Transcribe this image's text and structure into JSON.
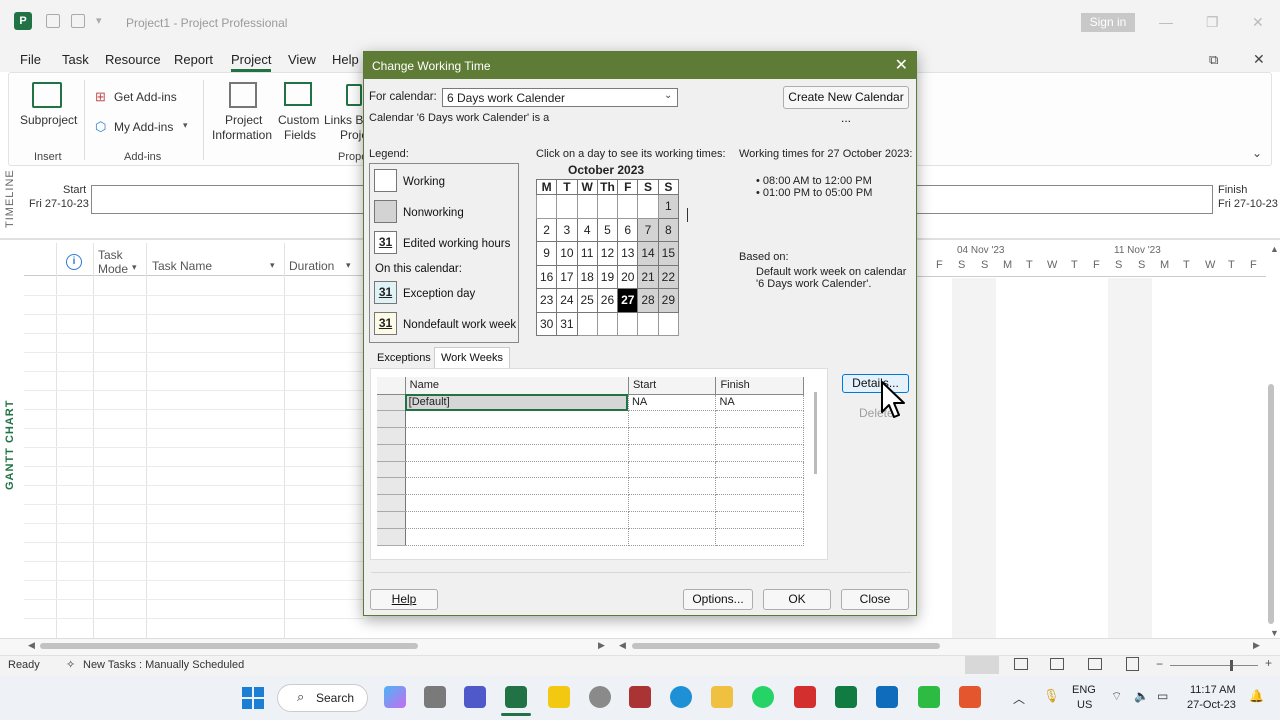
{
  "app": {
    "title": "Project1  -  Project Professional",
    "sign_in": "Sign in",
    "icon_letter": "P"
  },
  "menu": [
    "File",
    "Task",
    "Resource",
    "Report",
    "Project",
    "View",
    "Help"
  ],
  "ribbon": {
    "subproject": "Subproject",
    "insert_group": "Insert",
    "get_addins": "Get Add-ins",
    "my_addins": "My Add-ins",
    "addins_group": "Add-ins",
    "project_information_1": "Project",
    "project_information_2": "Information",
    "custom_fields_1": "Custom",
    "custom_fields_2": "Fields",
    "links_between_1": "Links Be",
    "links_between_2": "Proje",
    "properties_group": "Prope"
  },
  "timeline": {
    "side_label": "TIMELINE",
    "start_label": "Start",
    "start_date": "Fri 27-10-23",
    "finish_label": "Finish",
    "finish_date": "Fri 27-10-23"
  },
  "gantt": {
    "side_label": "GANTT CHART",
    "col_task_mode_1": "Task",
    "col_task_mode_2": "Mode",
    "col_task_name": "Task Name",
    "col_duration": "Duration",
    "week1": "04 Nov '23",
    "week2": "11 Nov '23",
    "day_letters": [
      "F",
      "S",
      "S",
      "M",
      "T",
      "W",
      "T",
      "F",
      "S",
      "S",
      "M",
      "T",
      "W",
      "T",
      "F"
    ]
  },
  "status": {
    "ready": "Ready",
    "new_tasks": "New Tasks : Manually Scheduled"
  },
  "taskbar": {
    "search": "Search",
    "lang1": "ENG",
    "lang2": "US",
    "time": "11:17 AM",
    "date": "27-Oct-23"
  },
  "dialog": {
    "title": "Change Working Time",
    "for_calendar_label": "For calendar:",
    "calendar_value": "6 Days work Calender",
    "create_new_calendar": "Create New Calendar ...",
    "calendar_note": "Calendar '6 Days work Calender' is a",
    "legend_label": "Legend:",
    "legend": {
      "working": "Working",
      "nonworking": "Nonworking",
      "edited": "Edited working hours",
      "on_this_calendar": "On this calendar:",
      "exception_day": "Exception day",
      "nondefault": "Nondefault work week",
      "day_number": "31"
    },
    "click_hint": "Click on a day to see its working times:",
    "month_title": "October 2023",
    "weekdays": [
      "M",
      "T",
      "W",
      "Th",
      "F",
      "S",
      "S"
    ],
    "calendar_rows": [
      [
        "",
        "",
        "",
        "",
        "",
        "",
        "1"
      ],
      [
        "2",
        "3",
        "4",
        "5",
        "6",
        "7",
        "8"
      ],
      [
        "9",
        "10",
        "11",
        "12",
        "13",
        "14",
        "15"
      ],
      [
        "16",
        "17",
        "18",
        "19",
        "20",
        "21",
        "22"
      ],
      [
        "23",
        "24",
        "25",
        "26",
        "27",
        "28",
        "29"
      ],
      [
        "30",
        "31",
        "",
        "",
        "",
        "",
        ""
      ]
    ],
    "selected_day": "27",
    "working_times_title": "Working times for 27 October 2023:",
    "working_times": [
      "• 08:00 AM to 12:00 PM",
      "• 01:00 PM to 05:00 PM"
    ],
    "based_on_label": "Based on:",
    "based_on_line1": "Default work week on calendar",
    "based_on_line2": "'6 Days work Calender'.",
    "tabs": [
      "Exceptions",
      "Work Weeks"
    ],
    "table": {
      "headers": [
        "Name",
        "Start",
        "Finish"
      ],
      "row1": {
        "name": "[Default]",
        "start": "NA",
        "finish": "NA"
      }
    },
    "details_button": "Details...",
    "delete_button": "Delete",
    "help_button": "Help",
    "options_button": "Options...",
    "ok_button": "OK",
    "close_button": "Close"
  },
  "colors": {
    "accent_green": "#217346",
    "dialog_title_bg": "#5f7c36",
    "nonworking_gray": "#d3d3d3"
  }
}
